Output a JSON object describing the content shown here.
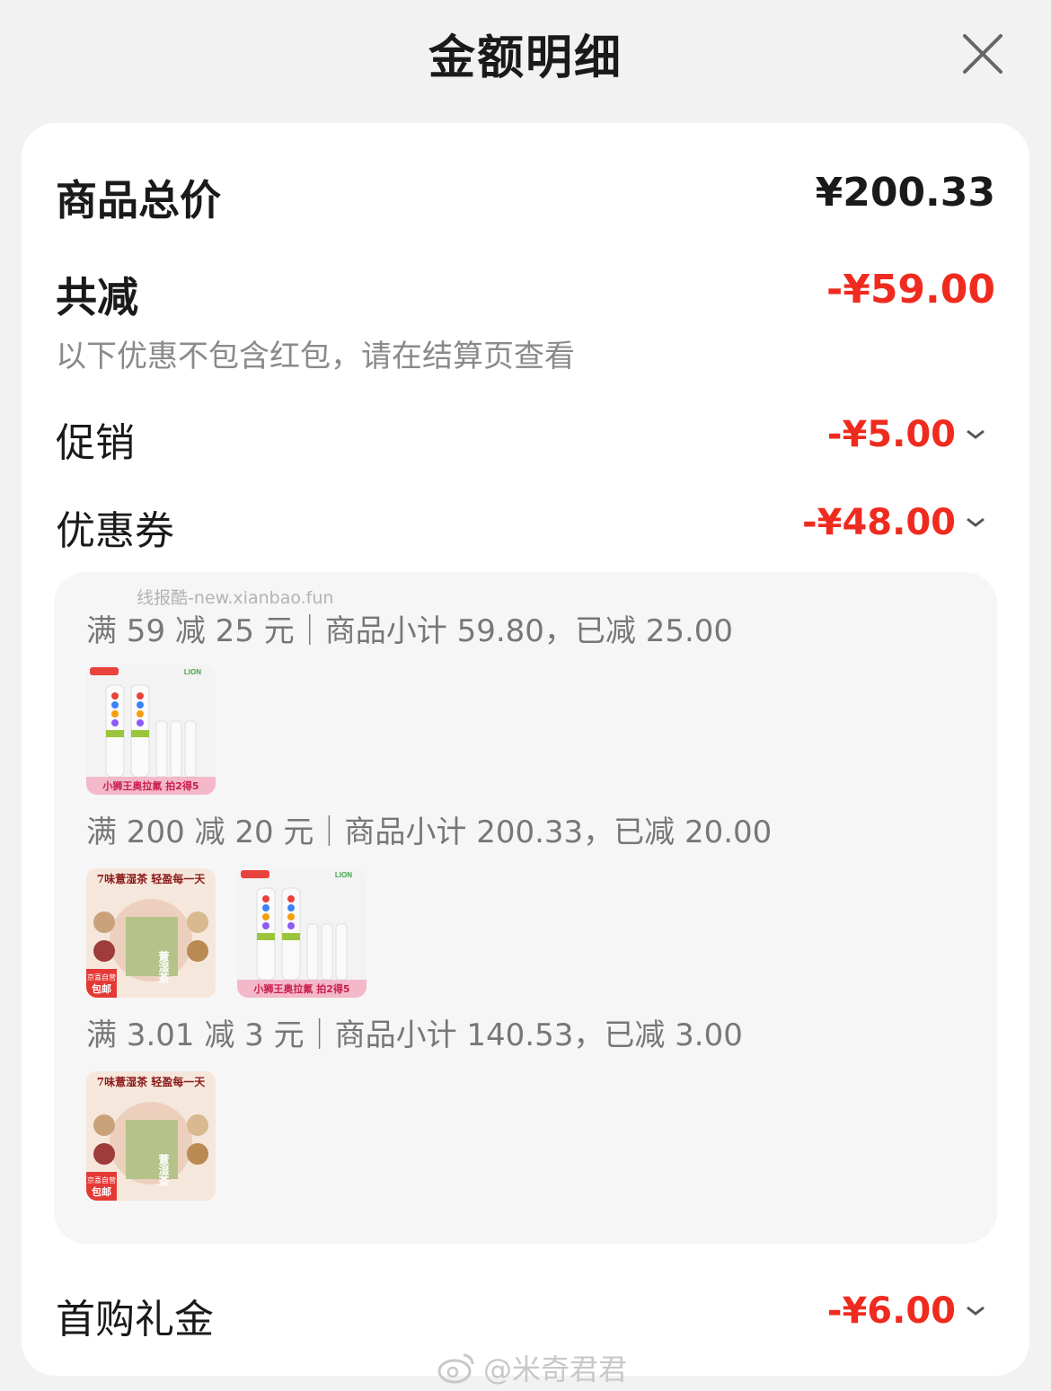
{
  "header": {
    "title": "金额明细"
  },
  "summary": {
    "total_label": "商品总价",
    "total_value": "¥200.33",
    "discount_label": "共减",
    "discount_value": "-¥59.00",
    "note": "以下优惠不包含红包，请在结算页查看"
  },
  "rows": {
    "promo_label": "促销",
    "promo_value": "-¥5.00",
    "coupon_label": "优惠券",
    "coupon_value": "-¥48.00",
    "first_gift_label": "首购礼金",
    "first_gift_value": "-¥6.00"
  },
  "coupons": [
    {
      "text": "满 59 减 25 元｜商品小计 59.80，已减 25.00"
    },
    {
      "text": "满 200 减 20 元｜商品小计 200.33，已减 20.00"
    },
    {
      "text": "满 3.01 减 3 元｜商品小计 140.53，已减 3.00"
    }
  ],
  "products": {
    "toothpaste_banner": "小狮王奥拉氟 拍2得5",
    "toothpaste_brand": "LION",
    "tea_headline": "7味薏湿茶 轻盈每一天",
    "tea_name": "薏湿茶",
    "tea_badge_top": "京喜自营",
    "tea_badge_bottom": "包邮"
  },
  "watermarks": {
    "top": "线报酷-new.xianbao.fun",
    "bottom": "@米奇君君"
  },
  "colors": {
    "accent_red": "#ef2b1f",
    "background": "#f2f2f2",
    "card": "#ffffff"
  }
}
